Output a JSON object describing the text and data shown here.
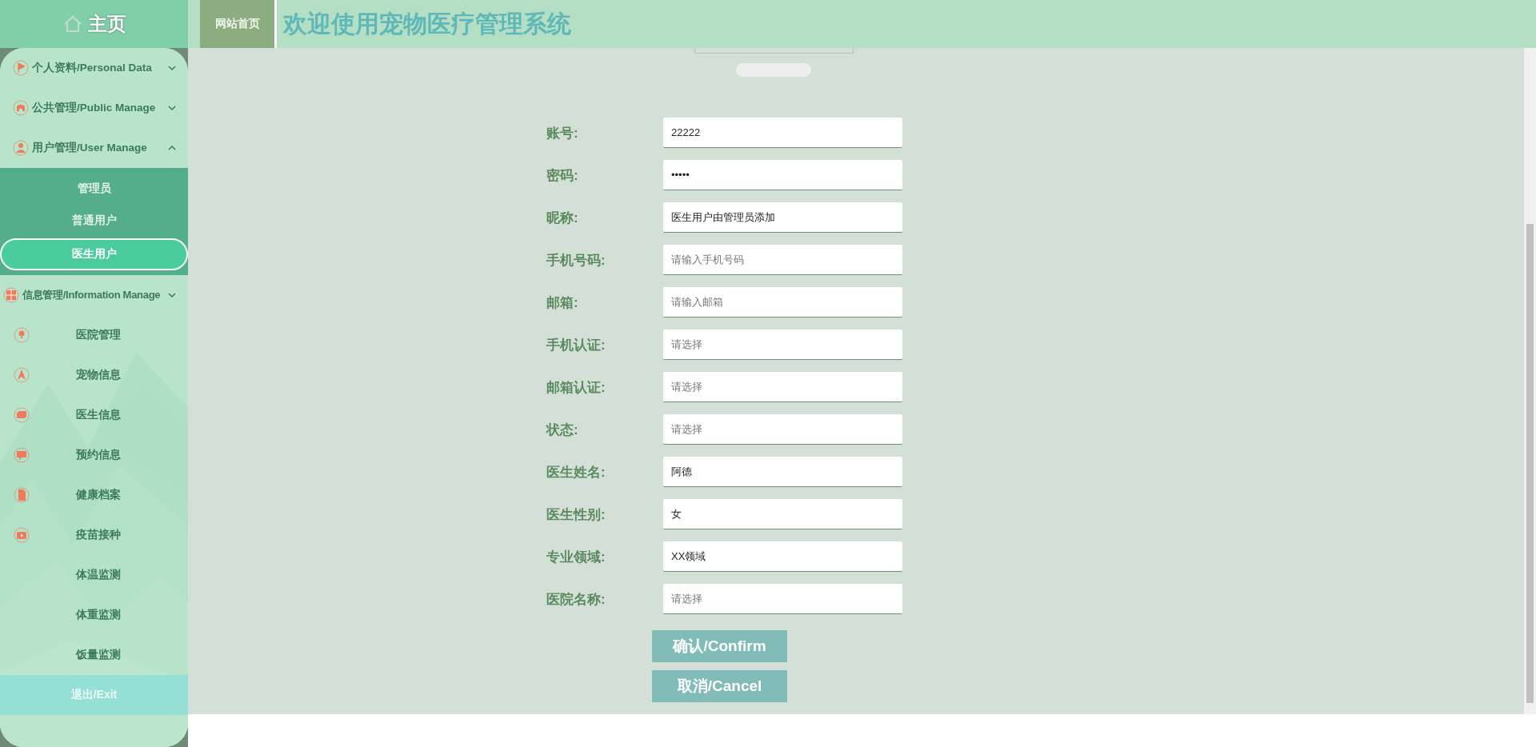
{
  "sidebar": {
    "home": {
      "label": "主页"
    },
    "groups": [
      {
        "label": "个人资料/Personal Data",
        "expanded": false
      },
      {
        "label": "公共管理/Public Manage",
        "expanded": false
      },
      {
        "label": "用户管理/User Manage",
        "expanded": true,
        "children": [
          {
            "label": "管理员",
            "selected": false
          },
          {
            "label": "普通用户",
            "selected": false
          },
          {
            "label": "医生用户",
            "selected": true
          }
        ]
      },
      {
        "label": "信息管理/Information Manage",
        "expanded": false,
        "children": [
          {
            "label": "医院管理",
            "selected": false
          },
          {
            "label": "宠物信息",
            "selected": false
          },
          {
            "label": "医生信息",
            "selected": false
          },
          {
            "label": "预约信息",
            "selected": false
          },
          {
            "label": "健康档案",
            "selected": false
          },
          {
            "label": "疫苗接种",
            "selected": false
          },
          {
            "label": "体温监测",
            "selected": false
          },
          {
            "label": "体重监测",
            "selected": false
          },
          {
            "label": "饭量监测",
            "selected": false
          }
        ]
      }
    ],
    "exit": {
      "label": "退出/Exit"
    }
  },
  "header": {
    "nav_tab": "网站首页",
    "title": "欢迎使用宠物医疗管理系统"
  },
  "form": {
    "fields": [
      {
        "label": "账号:",
        "value": "22222"
      },
      {
        "label": "密码:",
        "value": "•••••"
      },
      {
        "label": "昵称:",
        "value": "医生用户由管理员添加"
      },
      {
        "label": "手机号码:",
        "placeholder": "请输入手机号码"
      },
      {
        "label": "邮箱:",
        "placeholder": "请输入邮箱"
      },
      {
        "label": "手机认证:",
        "placeholder": "请选择"
      },
      {
        "label": "邮箱认证:",
        "placeholder": "请选择"
      },
      {
        "label": "状态:",
        "placeholder": "请选择"
      },
      {
        "label": "医生姓名:",
        "value": "阿德"
      },
      {
        "label": "医生性别:",
        "value": "女"
      },
      {
        "label": "专业领域:",
        "value": "XX领域"
      },
      {
        "label": "医院名称:",
        "placeholder": "请选择"
      }
    ],
    "buttons": [
      {
        "label": "确认/Confirm"
      },
      {
        "label": "取消/Cancel"
      }
    ]
  }
}
